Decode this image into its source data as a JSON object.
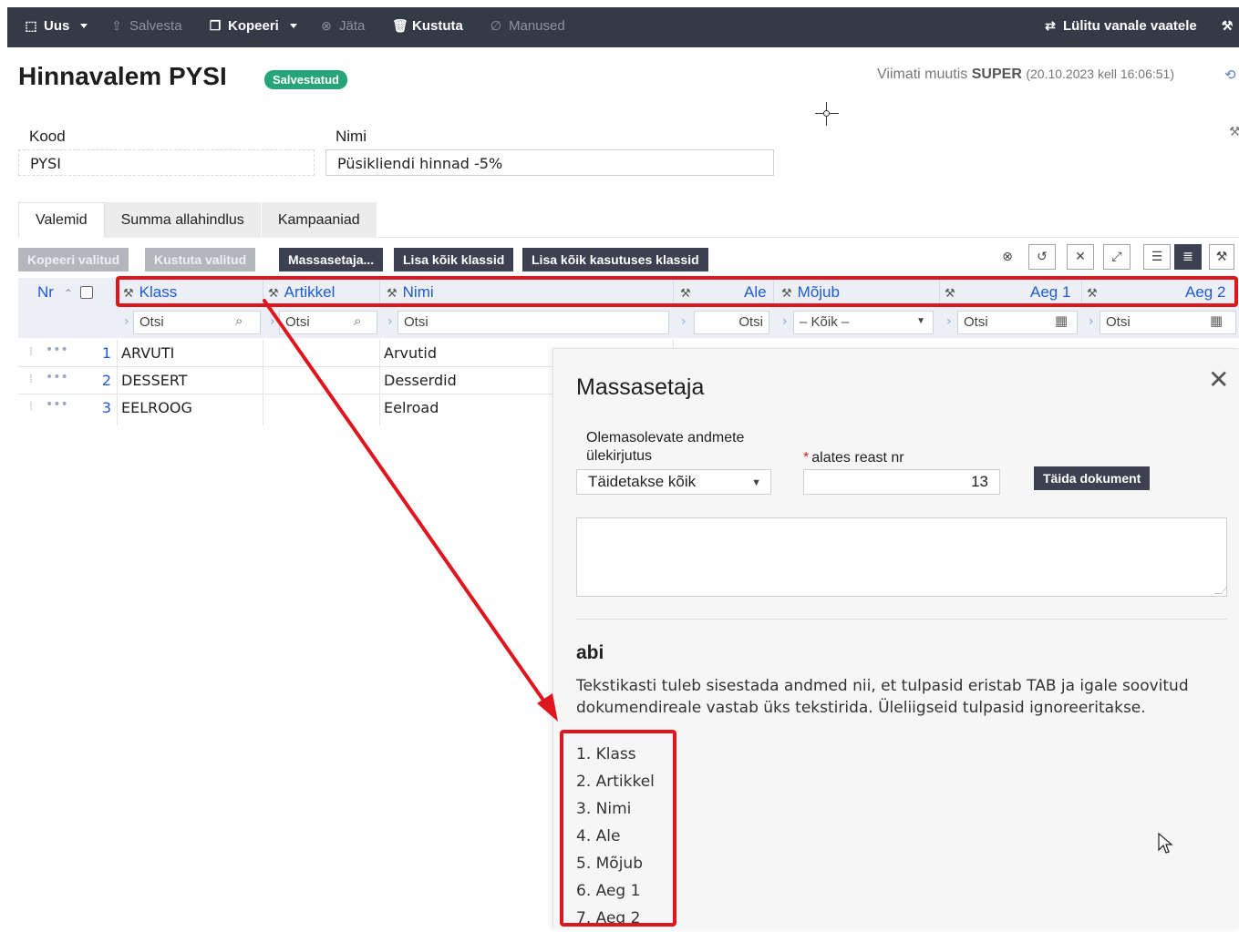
{
  "toolbar": {
    "new_label": "Uus",
    "save_label": "Salvesta",
    "copy_label": "Kopeeri",
    "skip_label": "Jäta",
    "delete_label": "Kustuta",
    "attachments_label": "Manused",
    "switch_view_label": "Lülitu vanale vaatele"
  },
  "header": {
    "title": "Hinnavalem PYSI",
    "status_badge": "Salvestatud",
    "last_modified_prefix": "Viimati muutis",
    "last_modified_user": "SUPER",
    "last_modified_time": "(20.10.2023 kell 16:06:51)"
  },
  "form": {
    "code_label": "Kood",
    "code_value": "PYSI",
    "name_label": "Nimi",
    "name_value": "Püsikliendi hinnad -5%"
  },
  "tabs": [
    "Valemid",
    "Summa allahindlus",
    "Kampaaniad"
  ],
  "actions": {
    "copy_selected": "Kopeeri valitud",
    "delete_selected": "Kustuta valitud",
    "mass_setter": "Massasetaja...",
    "add_all_classes": "Lisa kõik klassid",
    "add_all_used_classes": "Lisa kõik kasutuses klassid"
  },
  "grid": {
    "columns": {
      "nr": "Nr",
      "klass": "Klass",
      "artikkel": "Artikkel",
      "nimi": "Nimi",
      "ale": "Ale",
      "mojub": "Mõjub",
      "aeg1": "Aeg 1",
      "aeg2": "Aeg 2"
    },
    "filters": {
      "search_placeholder": "Otsi",
      "mojub_value": "– Kõik –"
    },
    "rows": [
      {
        "nr": "1",
        "klass": "ARVUTI",
        "artikkel": "",
        "nimi": "Arvutid"
      },
      {
        "nr": "2",
        "klass": "DESSERT",
        "artikkel": "",
        "nimi": "Desserdid"
      },
      {
        "nr": "3",
        "klass": "EELROOG",
        "artikkel": "",
        "nimi": "Eelroad"
      }
    ]
  },
  "modal": {
    "title": "Massasetaja",
    "overwrite_label": "Olemasolevate andmete ülekirjutus",
    "overwrite_value": "Täidetakse kõik",
    "from_row_label": "alates reast nr",
    "from_row_value": "13",
    "fill_button": "Täida dokument",
    "textarea_value": "",
    "help_title": "abi",
    "help_text": "Tekstikasti tuleb sisestada andmed nii, et tulpasid eristab TAB ja igale soovitud dokumendireale vastab üks tekstirida. Üleliigseid tulpasid ignoreeritakse.",
    "columns_list": [
      "1. Klass",
      "2. Artikkel",
      "3. Nimi",
      "4. Ale",
      "5. Mõjub",
      "6. Aeg 1",
      "7. Aeg 2"
    ]
  },
  "annotation_color": "#e0161f",
  "accent_color": "#343a46",
  "badge_color": "#28a47a"
}
